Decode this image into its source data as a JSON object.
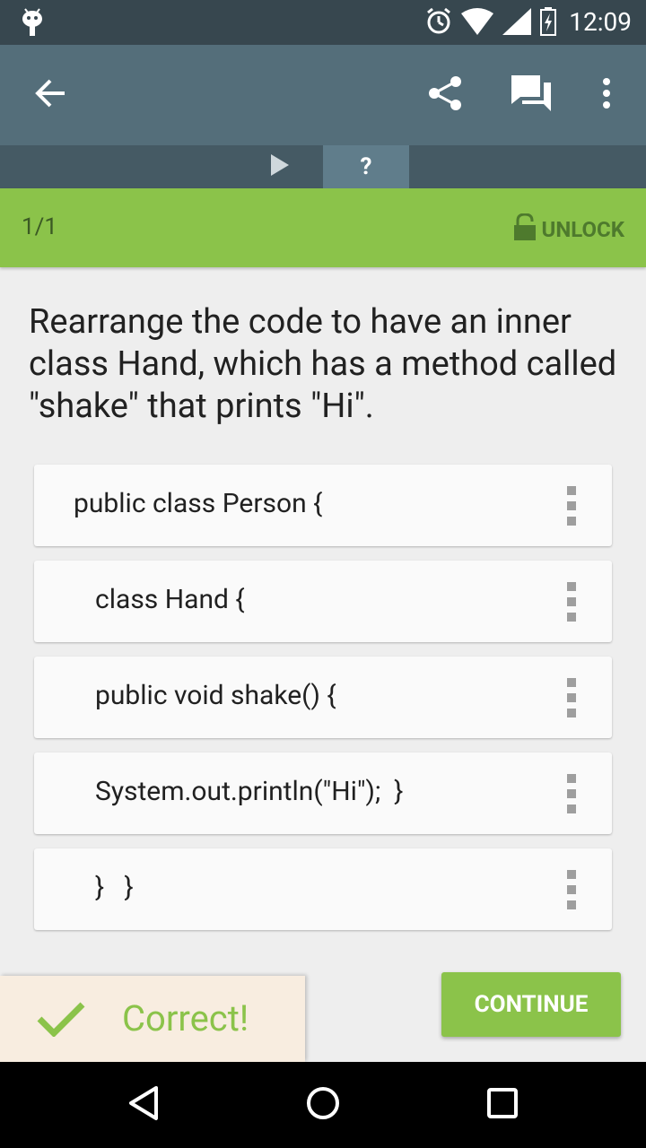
{
  "status_bar": {
    "time": "12:09",
    "icons": [
      "android-icon",
      "alarm-icon",
      "wifi-icon",
      "signal-icon",
      "battery-icon"
    ]
  },
  "app_bar": {
    "icons": [
      "back-arrow-icon",
      "share-icon",
      "comments-icon",
      "more-vert-icon"
    ]
  },
  "tabs": {
    "play_icon": "play-icon",
    "question_label": "?"
  },
  "progress": {
    "counter": "1/1",
    "unlock_label": "UNLOCK"
  },
  "question": {
    "text": "Rearrange the code to have an inner class Hand, which has a method called \"shake\" that prints \"Hi\"."
  },
  "code_lines": [
    {
      "text": "public class Person {"
    },
    {
      "text": "class Hand {"
    },
    {
      "text": "public void shake() {"
    },
    {
      "text": "System.out.println(\"Hi\");  }"
    },
    {
      "text": "}   }"
    }
  ],
  "actions": {
    "continue_label": "CONTINUE"
  },
  "result": {
    "text": "Correct!"
  },
  "colors": {
    "accent": "#8bc34a",
    "app_bar": "#546e7a",
    "status_bar": "#37474f"
  },
  "nav_bar": {
    "icons": [
      "back-nav-icon",
      "home-nav-icon",
      "recents-nav-icon"
    ]
  }
}
